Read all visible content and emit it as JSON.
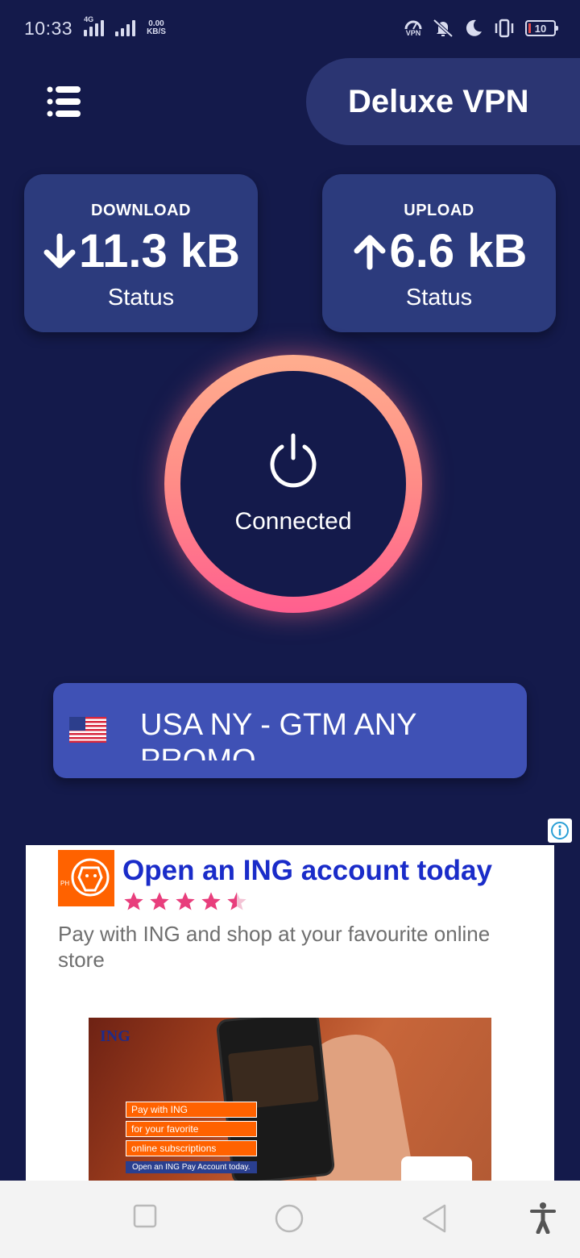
{
  "status_bar": {
    "time": "10:33",
    "network_type": "4G",
    "net_speed_value": "0.00",
    "net_speed_unit": "KB/S",
    "vpn_label": "VPN",
    "battery": "10"
  },
  "header": {
    "title": "Deluxe VPN"
  },
  "stats": {
    "download": {
      "title": "DOWNLOAD",
      "value": "11.3 kB",
      "status": "Status"
    },
    "upload": {
      "title": "UPLOAD",
      "value": "6.6 kB",
      "status": "Status"
    }
  },
  "power": {
    "label": "Connected"
  },
  "server": {
    "name": "USA NY - GTM ANY PROMO"
  },
  "ad": {
    "headline": "Open an ING account today",
    "rating": 4.5,
    "body": "Pay with ING and shop at your favourite online store",
    "image_brand": "ING",
    "image_tags": [
      "Pay with ING",
      "for your favorite",
      "online subscriptions"
    ],
    "image_cta": "Open an ING Pay Account today."
  },
  "colors": {
    "background": "#141a4b",
    "card": "#2c3b7d",
    "server_button": "#3f51b5",
    "ring_top": "#ffae8e",
    "ring_bottom": "#ff5f8f",
    "ad_headline": "#1a2cc9",
    "star": "#e83e7c"
  }
}
